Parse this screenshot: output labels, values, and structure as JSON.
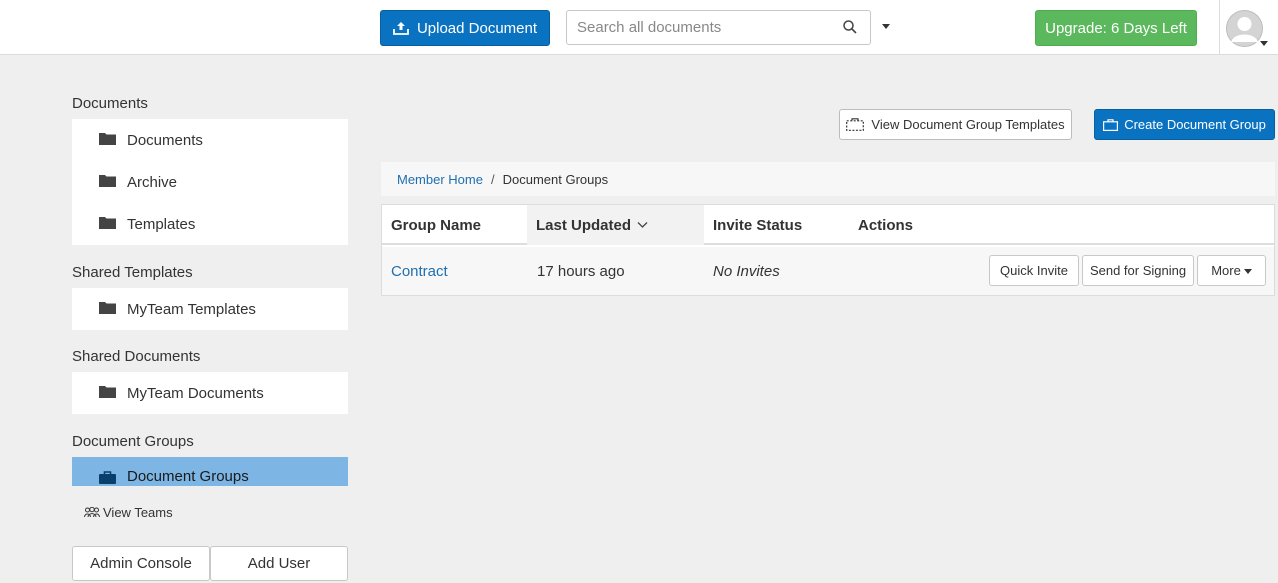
{
  "header": {
    "upload_label": "Upload Document",
    "search_placeholder": "Search all documents",
    "upgrade_label": "Upgrade: 6 Days Left"
  },
  "sidebar": {
    "sections": [
      {
        "heading": "Documents",
        "items": [
          {
            "label": "Documents",
            "icon": "folder-icon"
          },
          {
            "label": "Archive",
            "icon": "folder-icon"
          },
          {
            "label": "Templates",
            "icon": "folder-icon"
          }
        ]
      },
      {
        "heading": "Shared Templates",
        "items": [
          {
            "label": "MyTeam Templates",
            "icon": "folder-icon"
          }
        ]
      },
      {
        "heading": "Shared Documents",
        "items": [
          {
            "label": "MyTeam Documents",
            "icon": "folder-icon"
          }
        ]
      },
      {
        "heading": "Document Groups",
        "items": [
          {
            "label": "Document Groups",
            "icon": "briefcase-icon",
            "active": true
          }
        ]
      }
    ],
    "view_teams": "View Teams",
    "admin_console": "Admin Console",
    "add_user": "Add User"
  },
  "main": {
    "view_templates_label": "View Document Group Templates",
    "create_group_label": "Create Document Group",
    "breadcrumb": {
      "home": "Member Home",
      "separator": "/",
      "current": "Document Groups"
    },
    "table": {
      "columns": [
        "Group Name",
        "Last Updated",
        "Invite Status",
        "Actions"
      ],
      "sorted_column": "Last Updated",
      "rows": [
        {
          "name": "Contract",
          "updated": "17 hours ago",
          "status": "No Invites",
          "actions": [
            "Quick Invite",
            "Send for Signing",
            "More"
          ]
        }
      ]
    }
  },
  "colors": {
    "primary": "#0a73c1",
    "success": "#5cb85c",
    "active_item": "#7db6e4",
    "link": "#1f6fb0"
  }
}
